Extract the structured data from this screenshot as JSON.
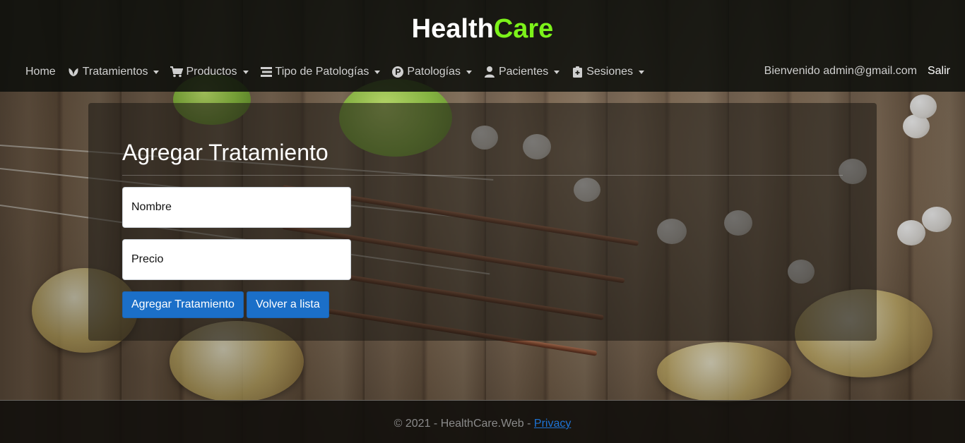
{
  "brand": {
    "part1": "Health",
    "part2": "Care"
  },
  "nav": {
    "items": [
      {
        "label": "Home",
        "icon": ""
      },
      {
        "label": "Tratamientos",
        "icon": "leaf-icon"
      },
      {
        "label": "Productos",
        "icon": "cart-icon"
      },
      {
        "label": "Tipo de Patologías",
        "icon": "list-icon"
      },
      {
        "label": "Patologías",
        "icon": "parking-circle-icon"
      },
      {
        "label": "Pacientes",
        "icon": "user-icon"
      },
      {
        "label": "Sesiones",
        "icon": "clipboard-icon"
      }
    ],
    "welcome": "Bienvenido admin@gmail.com",
    "logout": "Salir"
  },
  "form": {
    "title": "Agregar Tratamiento",
    "nombre_placeholder": "Nombre",
    "precio_placeholder": "Precio",
    "submit_label": "Agregar Tratamiento",
    "back_label": "Volver a lista"
  },
  "footer": {
    "text": "© 2021 - HealthCare.Web - ",
    "privacy_label": "Privacy"
  },
  "colors": {
    "accent": "#7cf21a",
    "primary_button": "#1b6fc8",
    "link": "#1e74d6"
  }
}
